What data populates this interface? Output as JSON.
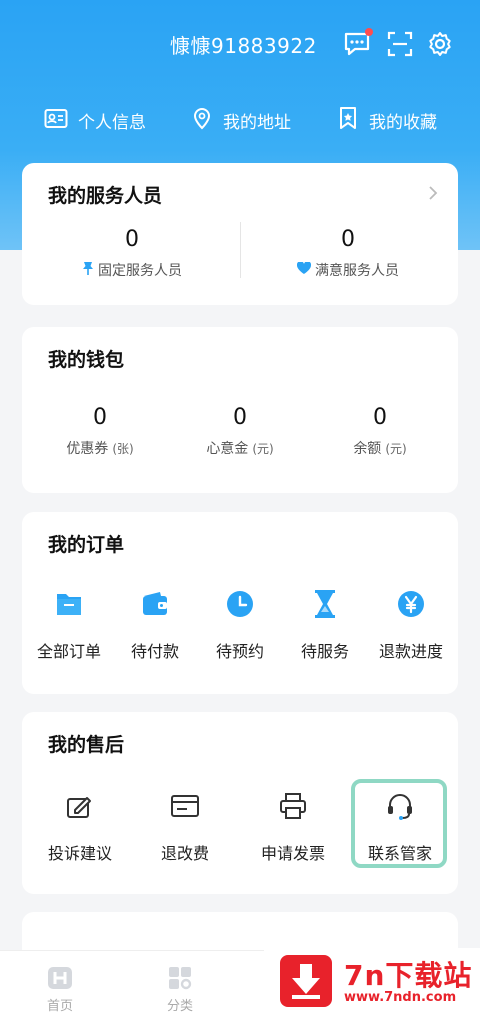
{
  "header": {
    "username": "慷慷91883922",
    "icons": [
      "message-icon",
      "scan-icon",
      "settings-icon"
    ],
    "accent": "#2aa3f4"
  },
  "quick_links": [
    {
      "label": "个人信息",
      "icon": "id-card-icon"
    },
    {
      "label": "我的地址",
      "icon": "location-icon"
    },
    {
      "label": "我的收藏",
      "icon": "bookmark-icon"
    }
  ],
  "service_staff": {
    "title": "我的服务人员",
    "items": [
      {
        "value": "0",
        "label": "固定服务人员",
        "icon": "pin-icon"
      },
      {
        "value": "0",
        "label": "满意服务人员",
        "icon": "heart-icon"
      }
    ]
  },
  "wallet": {
    "title": "我的钱包",
    "items": [
      {
        "value": "0",
        "label": "优惠券",
        "unit": "(张)"
      },
      {
        "value": "0",
        "label": "心意金",
        "unit": "(元)"
      },
      {
        "value": "0",
        "label": "余额",
        "unit": "(元)"
      }
    ]
  },
  "orders": {
    "title": "我的订单",
    "items": [
      {
        "label": "全部订单",
        "icon": "folder-icon"
      },
      {
        "label": "待付款",
        "icon": "wallet-icon"
      },
      {
        "label": "待预约",
        "icon": "clock-icon"
      },
      {
        "label": "待服务",
        "icon": "hourglass-icon"
      },
      {
        "label": "退款进度",
        "icon": "yen-icon"
      }
    ]
  },
  "after_sales": {
    "title": "我的售后",
    "items": [
      {
        "label": "投诉建议",
        "icon": "edit-icon"
      },
      {
        "label": "退改费",
        "icon": "card-icon"
      },
      {
        "label": "申请发票",
        "icon": "printer-icon"
      },
      {
        "label": "联系管家",
        "icon": "headset-icon"
      }
    ]
  },
  "tabbar": {
    "tabs": [
      {
        "label": "首页",
        "icon": "home-icon"
      },
      {
        "label": "分类",
        "icon": "category-icon"
      }
    ]
  },
  "watermark": {
    "title": "7n下载站",
    "url": "www.7ndn.com"
  }
}
